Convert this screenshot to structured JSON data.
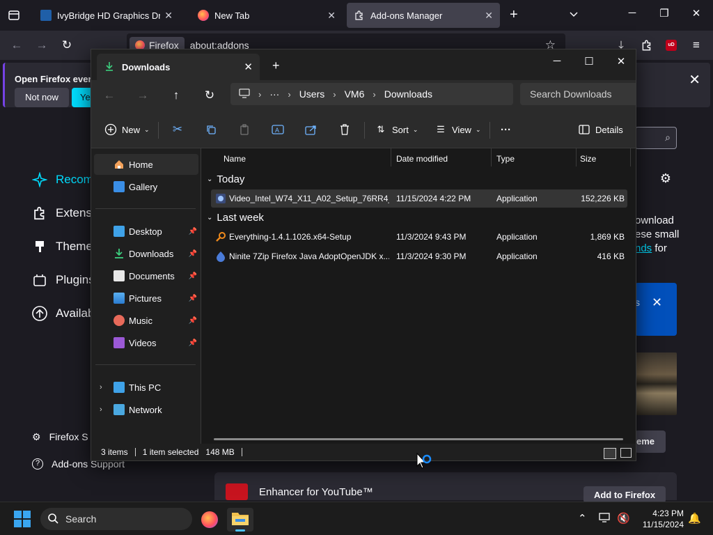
{
  "firefox": {
    "tabs": [
      {
        "title": "IvyBridge HD Graphics Driver | D",
        "close": "✕"
      },
      {
        "title": "New Tab",
        "close": "✕"
      },
      {
        "title": "Add-ons Manager",
        "close": "✕"
      }
    ],
    "new_tab": "+",
    "url_identity": "Firefox",
    "url": "about:addons",
    "notification": {
      "text": "Open Firefox every",
      "not_now": "Not now",
      "yes": "Yes,"
    },
    "categories": [
      {
        "label": "Recomm",
        "icon": "sparkle-icon"
      },
      {
        "label": "Extensio",
        "icon": "puzzle-icon"
      },
      {
        "label": "Themes",
        "icon": "brush-icon"
      },
      {
        "label": "Plugins",
        "icon": "plugin-icon"
      },
      {
        "label": "Availab",
        "icon": "arrow-up-circle-icon"
      }
    ],
    "footer": [
      {
        "label": "Firefox S",
        "icon": "gear-icon"
      },
      {
        "label": "Add-ons Support",
        "icon": "help-icon"
      }
    ],
    "right_panel": {
      "line1": "ownload",
      "line2": "ese small",
      "line3_link": "nds",
      "line3_rest": " for",
      "blue_card_text": "s",
      "theme_button": "eme"
    },
    "bottom_card": {
      "title": "Enhancer for YouTube™",
      "button": "Add to Firefox"
    }
  },
  "explorer": {
    "tab_title": "Downloads",
    "tab_close": "✕",
    "new_tab": "+",
    "breadcrumb": [
      "Users",
      "VM6",
      "Downloads"
    ],
    "breadcrumb_more": "···",
    "search_placeholder": "Search Downloads",
    "commands": {
      "new": "New",
      "sort": "Sort",
      "view": "View",
      "more": "···",
      "details": "Details"
    },
    "nav": {
      "home": "Home",
      "gallery": "Gallery",
      "desktop": "Desktop",
      "downloads": "Downloads",
      "documents": "Documents",
      "pictures": "Pictures",
      "music": "Music",
      "videos": "Videos",
      "this_pc": "This PC",
      "network": "Network"
    },
    "columns": {
      "name": "Name",
      "date": "Date modified",
      "type": "Type",
      "size": "Size"
    },
    "groups": [
      {
        "label": "Today",
        "files": [
          {
            "name": "Video_Intel_W74_X11_A02_Setup_76RR4_...",
            "date": "11/15/2024 4:22 PM",
            "type": "Application",
            "size": "152,226 KB",
            "selected": true,
            "icon": "intel-setup-icon"
          }
        ]
      },
      {
        "label": "Last week",
        "files": [
          {
            "name": "Everything-1.4.1.1026.x64-Setup",
            "date": "11/3/2024 9:43 PM",
            "type": "Application",
            "size": "1,869 KB",
            "selected": false,
            "icon": "magnifier-app-icon"
          },
          {
            "name": "Ninite 7Zip Firefox Java AdoptOpenJDK x...",
            "date": "11/3/2024 9:30 PM",
            "type": "Application",
            "size": "416 KB",
            "selected": false,
            "icon": "ninite-icon"
          }
        ]
      }
    ],
    "status": {
      "items": "3 items",
      "selected": "1 item selected",
      "size": "148 MB"
    }
  },
  "taskbar": {
    "search_label": "Search",
    "time": "4:23 PM",
    "date": "11/15/2024"
  },
  "colors": {
    "accent_cyan": "#00ddff",
    "selection_row": "#353535",
    "windows_blue": "#3aa6f0"
  }
}
